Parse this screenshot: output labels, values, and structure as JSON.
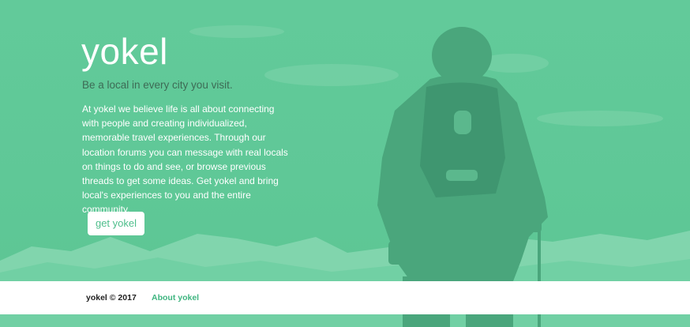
{
  "hero": {
    "title": "yokel",
    "tagline": "Be a local in every city you visit.",
    "description": "At yokel we believe life is all about connecting with people and creating individualized, memorable travel experiences. Through our location forums you can message with real locals on things to do and see, or browse previous threads to get some ideas. Get yokel and bring local's experiences to you and the entire community.",
    "cta_label": "get yokel",
    "background_image": "hiker-mountains-photo"
  },
  "footer": {
    "copyright": "yokel © 2017",
    "about_link": "About yokel"
  },
  "colors": {
    "overlay_green": "#5cc896",
    "tagline_text": "#3d6b55",
    "button_bg": "#ffffff",
    "button_text": "#4fbe8c",
    "footer_bg": "#ffffff",
    "footer_link": "#3fb580"
  }
}
